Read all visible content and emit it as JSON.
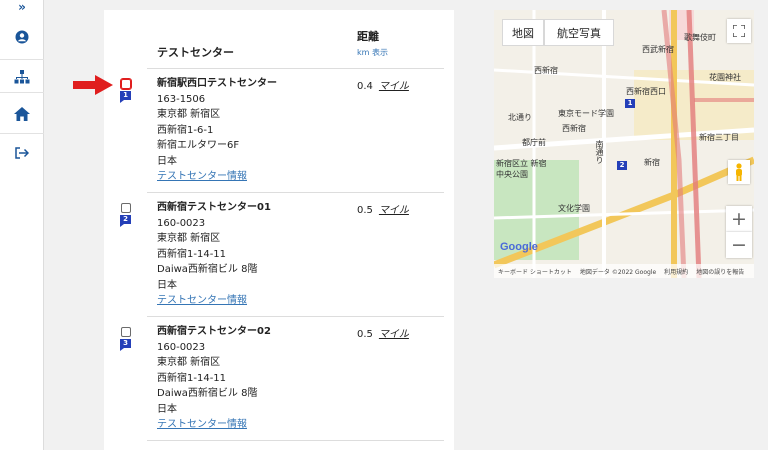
{
  "header": {
    "title": "テストセンター",
    "distance_title": "距離",
    "distance_sub": "km 表示"
  },
  "results": [
    {
      "index": "1",
      "name": "新宿駅西口テストセンター",
      "postal": "163-1506",
      "city": "東京都 新宿区",
      "street": "西新宿1-6-1",
      "building": "新宿エルタワー6F",
      "country": "日本",
      "link": "テストセンター情報",
      "distance": "0.4",
      "unit": "マイル"
    },
    {
      "index": "2",
      "name": "西新宿テストセンター01",
      "postal": "160-0023",
      "city": "東京都 新宿区",
      "street": "西新宿1-14-11",
      "building": "Daiwa西新宿ビル 8階",
      "country": "日本",
      "link": "テストセンター情報",
      "distance": "0.5",
      "unit": "マイル"
    },
    {
      "index": "3",
      "name": "西新宿テストセンター02",
      "postal": "160-0023",
      "city": "東京都 新宿区",
      "street": "西新宿1-14-11",
      "building": "Daiwa西新宿ビル 8階",
      "country": "日本",
      "link": "テストセンター情報",
      "distance": "0.5",
      "unit": "マイル"
    }
  ],
  "map": {
    "tab_map": "地図",
    "tab_aerial": "航空写真",
    "fullscreen_icon": "fullscreen-icon",
    "zoom_in": "+",
    "zoom_out": "−",
    "google": "Google",
    "footer_shortcuts": "キーボード ショートカット",
    "footer_data": "地図データ ©2022 Google",
    "footer_terms": "利用規約",
    "footer_report": "地図の誤りを報告",
    "labels": {
      "kabukicho": "歌舞伎町",
      "seibu_shinjuku": "西武新宿",
      "shinjuku_nishiguchi": "西新宿",
      "hanazono": "花園神社",
      "kitadori": "北通り",
      "tokyo_mode": "東京モード学園",
      "nishi_shinjuku": "西新宿",
      "higashi_shinjuku_3": "新宿三丁目",
      "tochomae": "都庁前",
      "park": "新宿区立 新宿 中央公園",
      "bunka": "文化学園",
      "minamidori": "南通り",
      "shinjuku": "新宿",
      "nishi_shinjuku_station": "西新宿西口"
    }
  },
  "rail": {
    "expand_icon": "double-chevron-right-icon",
    "user_icon": "user-icon",
    "org_icon": "org-chart-icon",
    "home_icon": "home-icon",
    "logout_icon": "logout-icon"
  },
  "colors": {
    "accent_blue": "#3575b5",
    "pin_blue": "#243fb8",
    "rail_icon": "#1a5599",
    "annotation_red": "#e01e1e"
  }
}
